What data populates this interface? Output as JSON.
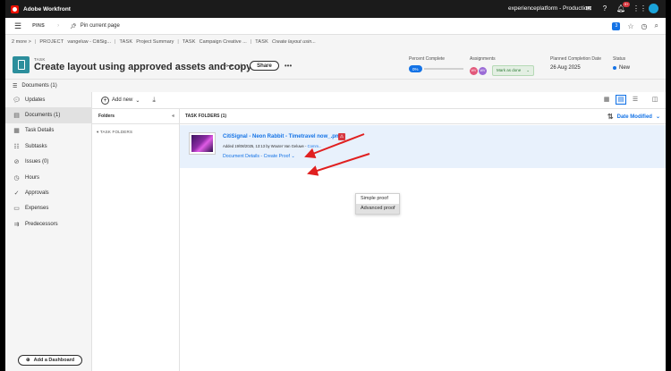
{
  "app": {
    "title": "Adobe Workfront",
    "org": "experienceplatform - Production",
    "notif_count": "9+"
  },
  "pinbar": {
    "pins_label": "PINS",
    "pin_current": "Pin current page",
    "badge": "3"
  },
  "breadcrumbs": {
    "more": "2 more",
    "items": [
      {
        "type": "PROJECT",
        "label": "vangeluw - CitiSig..."
      },
      {
        "type": "TASK",
        "label": "Project Summary"
      },
      {
        "type": "TASK",
        "label": "Campaign Creative ..."
      },
      {
        "type": "TASK",
        "label": "Create layout usin..."
      }
    ]
  },
  "task": {
    "type_label": "TASK",
    "title": "Create layout using approved assets and copy",
    "share_label": "Share",
    "percent_label": "Percent Complete",
    "percent_value": "0%",
    "assignments_label": "Assignments",
    "assignees": [
      {
        "initials": "WV",
        "color": "#e2587a"
      },
      {
        "initials": "WV",
        "color": "#9b6bd6"
      }
    ],
    "mark_done_label": "Mark as done",
    "planned_label": "Planned Completion Date",
    "planned_value": "26 Aug 2025",
    "status_label": "Status",
    "status_value": "New"
  },
  "docbar": {
    "label": "Documents (1)"
  },
  "sidebar": {
    "items": [
      {
        "label": "Updates",
        "icon": "chat-icon"
      },
      {
        "label": "Documents (1)",
        "icon": "document-icon",
        "active": true
      },
      {
        "label": "Task Details",
        "icon": "details-icon"
      },
      {
        "label": "Subtasks",
        "icon": "subtasks-icon"
      },
      {
        "label": "Issues (0)",
        "icon": "issues-icon"
      },
      {
        "label": "Hours",
        "icon": "clock-icon"
      },
      {
        "label": "Approvals",
        "icon": "approvals-icon"
      },
      {
        "label": "Expenses",
        "icon": "expenses-icon"
      },
      {
        "label": "Predecessors",
        "icon": "predecessors-icon"
      }
    ],
    "dashboard_label": "Add a Dashboard"
  },
  "content": {
    "add_new": "Add new",
    "folders_title": "Folders",
    "task_folders": "TASK FOLDERS",
    "main_title": "TASK FOLDERS (1)",
    "sort_label": "Date Modified",
    "document": {
      "name": "CitiSignal - Neon Rabbit - Timetravel now_.png",
      "added": "Added 19/08/2025, 13:13 by Wouter Van Geluwe -",
      "comment_link": "Comm...",
      "details_link": "Document Details",
      "link_sep": " - ",
      "create_proof": "Create Proof"
    },
    "dropdown": [
      "Simple proof",
      "Advanced proof"
    ]
  },
  "colors": {
    "accent": "#1473e6",
    "arrow": "#e02020"
  }
}
